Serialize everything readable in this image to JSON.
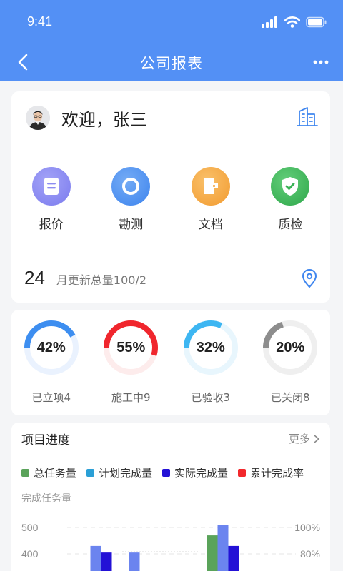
{
  "status_bar": {
    "time": "9:41"
  },
  "nav": {
    "title": "公司报表"
  },
  "welcome": {
    "text": "欢迎，张三"
  },
  "quick_actions": [
    {
      "label": "报价",
      "icon": "quote-doc-icon",
      "color": "#8a8af0"
    },
    {
      "label": "勘测",
      "icon": "survey-ring-icon",
      "color": "#4e92f0"
    },
    {
      "label": "文档",
      "icon": "document-icon",
      "color": "#f5a742"
    },
    {
      "label": "质检",
      "icon": "shield-check-icon",
      "color": "#3fb85b"
    }
  ],
  "monthly_stat": {
    "number": "24",
    "text": "月更新总量100/2"
  },
  "progress_rings": [
    {
      "percent_label": "42%",
      "value": 0.42,
      "label": "已立项4",
      "color": "#3d8ef0",
      "track": "#eaf2fe"
    },
    {
      "percent_label": "55%",
      "value": 0.55,
      "label": "施工中9",
      "color": "#f0262d",
      "track": "#fdecec"
    },
    {
      "percent_label": "32%",
      "value": 0.32,
      "label": "已验收3",
      "color": "#3db6f2",
      "track": "#e8f6fd"
    },
    {
      "percent_label": "20%",
      "value": 0.2,
      "label": "已关闭8",
      "color": "#8d8d8d",
      "track": "#efefef"
    }
  ],
  "project_progress": {
    "title": "项目进度",
    "more_label": "更多",
    "y_axis_title": "完成任务量"
  },
  "chart_data": {
    "type": "bar",
    "series": [
      {
        "name": "总任务量",
        "color": "#5aa35a",
        "values": [
          null,
          null,
          470
        ]
      },
      {
        "name": "计划完成量",
        "color": "#6b84ef",
        "values": [
          430,
          405,
          510
        ]
      },
      {
        "name": "实际完成量",
        "color": "#2311d6",
        "values": [
          405,
          null,
          430
        ]
      },
      {
        "name": "累计完成率",
        "color": "#f2282c",
        "values": []
      }
    ],
    "y_left_ticks": [
      "500",
      "400"
    ],
    "y_right_ticks": [
      "100%",
      "80%"
    ],
    "ylim_visible": [
      350,
      520
    ]
  }
}
